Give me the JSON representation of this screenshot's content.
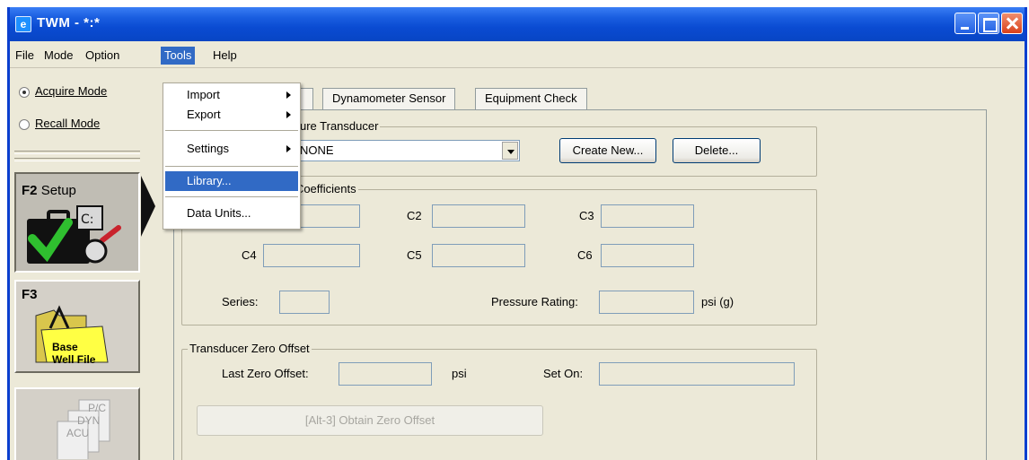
{
  "window": {
    "title": "TWM  -  *:*"
  },
  "menubar": {
    "items": [
      "File",
      "Mode",
      "Option",
      "Tools",
      "Help"
    ],
    "active": "Tools"
  },
  "tools_menu": {
    "import": "Import",
    "export": "Export",
    "settings": "Settings",
    "library": "Library...",
    "data_units": "Data Units..."
  },
  "sidebar": {
    "acquire_mode": "Acquire Mode",
    "recall_mode": "Recall Mode",
    "f2_key": "F2",
    "f2_label": "Setup",
    "f3_key": "F3",
    "f3_folder": "Base\nWell File",
    "f4_pages": [
      "P/C",
      "DYN",
      "ACU"
    ]
  },
  "tabs": [
    "Dynamometer Sensor",
    "Equipment Check"
  ],
  "pressure_transducer": {
    "group_title": "ssure Transducer",
    "selected": "NONE",
    "create_new": "Create New...",
    "delete": "Delete..."
  },
  "coefficients": {
    "group_title": "r Coefficients",
    "c2": "C2",
    "c3": "C3",
    "c4": "C4",
    "c5": "C5",
    "c6": "C6",
    "series": "Series:",
    "pressure_rating": "Pressure Rating:",
    "unit": "psi (g)"
  },
  "zero_offset": {
    "group_title": "Transducer Zero Offset",
    "last_zero_offset": "Last Zero Offset:",
    "unit": "psi",
    "set_on": "Set On:",
    "obtain_button": "[Alt-3]  Obtain Zero Offset"
  },
  "colors": {
    "titlebar": "#0a4bd2",
    "menu_highlight": "#316ac5",
    "face": "#ece9d8"
  }
}
